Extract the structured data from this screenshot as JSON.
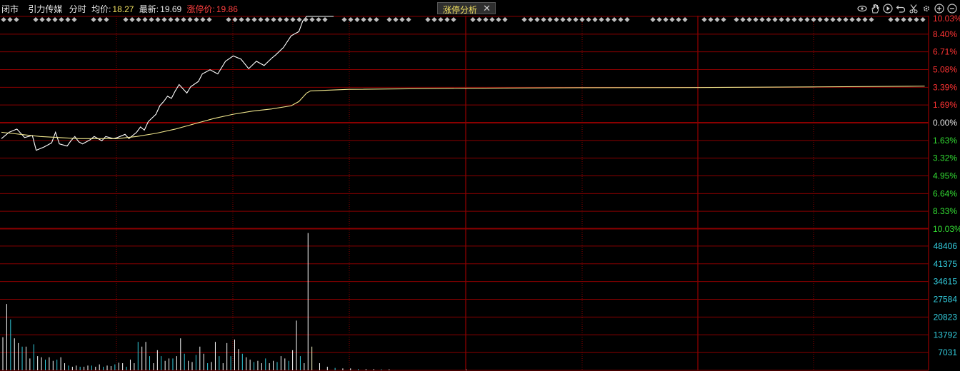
{
  "header": {
    "status": "闭市",
    "stock_name": "引力传媒",
    "mode": "分时",
    "avg_label": "均价:",
    "avg_value": "18.27",
    "last_label": "最新:",
    "last_value": "19.69",
    "limit_label": "涨停价:",
    "limit_value": "19.86"
  },
  "tab": {
    "label": "涨停分析",
    "close": "✕"
  },
  "toolbar": {
    "icons": [
      "eye-icon",
      "hand-icon",
      "play-icon",
      "undo-icon",
      "scissors-icon",
      "settings-icon",
      "zoom-in-icon",
      "zoom-out-icon"
    ]
  },
  "colors": {
    "background": "#000000",
    "grid": "#8a0000",
    "price_line": "#ffffff",
    "avg_line": "#f0e68c",
    "up_text": "#ff3333",
    "down_text": "#33dd33",
    "volume_text": "#33ccdd"
  },
  "chart_data": [
    {
      "type": "line",
      "title": "",
      "xlabel": "",
      "ylabel": "",
      "y_unit": "%",
      "ylim": [
        -10.03,
        10.03
      ],
      "y_ticks_up": [
        "10.03%",
        "8.40%",
        "6.71%",
        "5.08%",
        "3.39%",
        "1.69%",
        "0.00%"
      ],
      "y_ticks_down": [
        "1.63%",
        "3.32%",
        "4.95%",
        "6.64%",
        "8.33%",
        "10.03%"
      ],
      "x_count": 240,
      "series": [
        {
          "role": "price",
          "x": [
            0,
            2,
            4,
            6,
            8,
            9,
            11,
            13,
            14,
            15,
            17,
            18,
            19,
            20,
            21,
            23,
            24,
            25,
            26,
            27,
            29,
            30,
            32,
            33,
            35,
            36,
            37,
            38,
            40,
            41,
            42,
            43,
            44,
            45,
            46,
            47,
            48,
            49,
            51,
            52,
            54,
            56,
            58,
            60,
            62,
            64,
            66,
            68,
            70,
            71,
            73,
            75,
            77,
            78,
            79,
            80,
            81,
            82,
            83,
            85,
            86
          ],
          "values": [
            -1.5,
            -0.9,
            -0.6,
            -1.4,
            -1.2,
            -2.6,
            -2.3,
            -1.9,
            -0.9,
            -2.0,
            -2.2,
            -1.7,
            -1.3,
            -1.8,
            -2.0,
            -1.6,
            -1.3,
            -1.5,
            -1.7,
            -1.3,
            -1.5,
            -1.4,
            -1.1,
            -1.5,
            -0.9,
            -0.4,
            -0.7,
            0.1,
            0.8,
            1.6,
            2.0,
            2.5,
            2.3,
            3.0,
            3.6,
            3.2,
            2.8,
            3.4,
            3.9,
            4.6,
            5.0,
            4.6,
            5.8,
            6.3,
            6.0,
            5.1,
            5.8,
            5.4,
            6.1,
            6.4,
            7.1,
            8.2,
            8.6,
            9.6,
            10.03,
            10.03,
            10.03,
            10.03,
            10.03,
            10.03,
            10.03
          ]
        },
        {
          "role": "average",
          "x": [
            0,
            10,
            20,
            30,
            35,
            40,
            45,
            50,
            55,
            60,
            65,
            70,
            75,
            77,
            79,
            80,
            90,
            120,
            150,
            180,
            210,
            239
          ],
          "values": [
            -0.9,
            -1.3,
            -1.5,
            -1.5,
            -1.3,
            -1.0,
            -0.6,
            -0.1,
            0.4,
            0.8,
            1.1,
            1.3,
            1.6,
            2.0,
            2.8,
            3.0,
            3.15,
            3.25,
            3.3,
            3.32,
            3.38,
            3.45
          ]
        }
      ]
    },
    {
      "type": "bar",
      "title": "",
      "xlabel": "",
      "ylabel": "",
      "ylim": [
        0,
        60000
      ],
      "y_ticks": [
        "48406",
        "41375",
        "34615",
        "27584",
        "20823",
        "13792",
        "7031"
      ],
      "x_count": 240,
      "x": [
        0,
        1,
        2,
        3,
        4,
        5,
        6,
        7,
        8,
        9,
        10,
        11,
        12,
        13,
        14,
        15,
        16,
        17,
        18,
        19,
        20,
        21,
        22,
        23,
        24,
        25,
        26,
        27,
        28,
        29,
        30,
        31,
        32,
        33,
        34,
        35,
        36,
        37,
        38,
        39,
        40,
        41,
        42,
        43,
        44,
        45,
        46,
        47,
        48,
        49,
        50,
        51,
        52,
        53,
        54,
        55,
        56,
        57,
        58,
        59,
        60,
        61,
        62,
        63,
        64,
        65,
        66,
        67,
        68,
        69,
        70,
        71,
        72,
        73,
        74,
        75,
        76,
        77,
        78,
        79,
        80,
        82,
        84,
        86,
        88,
        90,
        92,
        94,
        96,
        98,
        100,
        120
      ],
      "values": [
        14000,
        28000,
        21500,
        13500,
        11500,
        10000,
        10000,
        5000,
        11000,
        6000,
        5500,
        4500,
        5500,
        4000,
        4500,
        5500,
        3000,
        2000,
        1500,
        2000,
        1500,
        1500,
        2000,
        2000,
        1500,
        2500,
        1500,
        2000,
        1800,
        2500,
        3200,
        3000,
        1500,
        4500,
        3000,
        12000,
        10000,
        12000,
        6000,
        3000,
        8500,
        6000,
        4000,
        5000,
        5000,
        6000,
        13500,
        7000,
        4000,
        3500,
        6500,
        10000,
        7000,
        3000,
        3500,
        12000,
        6000,
        3000,
        11500,
        6000,
        13000,
        9000,
        7000,
        5500,
        4500,
        3500,
        4000,
        3000,
        5000,
        3000,
        4000,
        3500,
        6000,
        5000,
        4000,
        8500,
        21000,
        6000,
        3000,
        58000,
        10000,
        3000,
        1500,
        1000,
        800,
        800,
        500,
        500,
        500,
        400,
        400,
        300
      ]
    }
  ]
}
